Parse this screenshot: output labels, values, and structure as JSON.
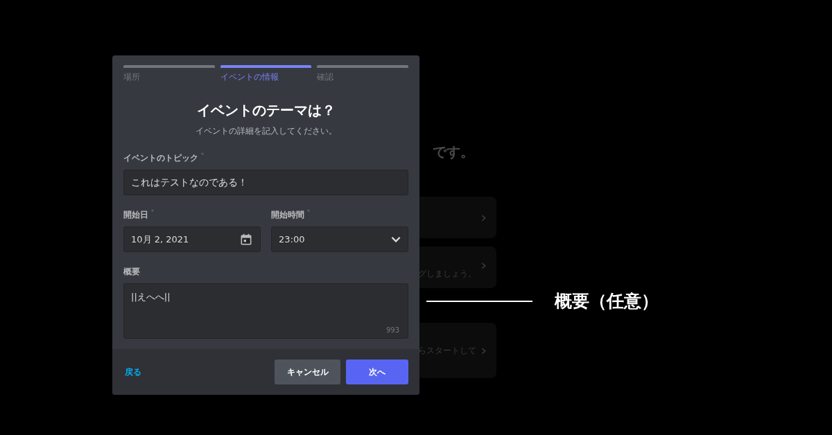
{
  "background": {
    "heading": "です。",
    "cards": [
      {
        "chevron": "›"
      },
      {
        "text": "グしましょう。",
        "chevron": "›"
      },
      {
        "text": "らスタートして",
        "chevron": "›"
      }
    ]
  },
  "dialog": {
    "steps": [
      {
        "label": "場所",
        "selected": false
      },
      {
        "label": "イベントの情報",
        "selected": true
      },
      {
        "label": "確認",
        "selected": false
      }
    ],
    "title": "イベントのテーマは？",
    "subtitle": "イベントの詳細を記入してください。",
    "rows": [
      [
        {
          "kind": "text",
          "label": "イベントのトピック",
          "required_mark": "*",
          "value": "これはテストなのである！"
        }
      ],
      [
        {
          "kind": "date",
          "label": "開始日",
          "required_mark": "*",
          "value": "10月 2, 2021"
        },
        {
          "kind": "select",
          "label": "開始時間",
          "required_mark": "*",
          "value": "23:00"
        }
      ],
      [
        {
          "kind": "textarea",
          "label": "概要",
          "value": "||えへへ||",
          "counter": "993"
        }
      ]
    ],
    "footer": {
      "back_link": "戻る",
      "buttons": [
        {
          "label": "キャンセル",
          "kind": "secondary"
        },
        {
          "label": "次へ",
          "kind": "primary"
        }
      ]
    }
  },
  "annotation": {
    "label": "概要（任意）"
  }
}
